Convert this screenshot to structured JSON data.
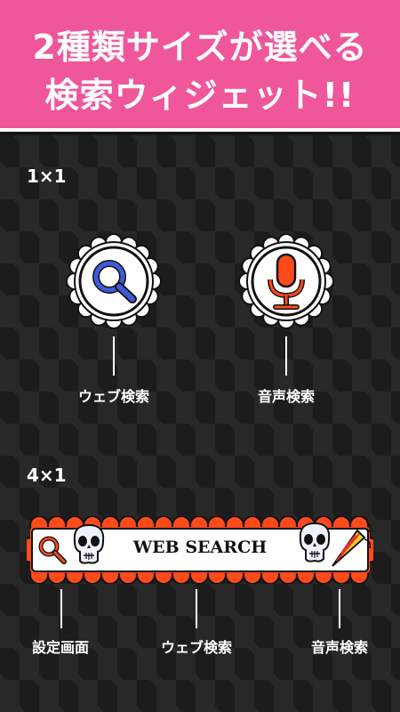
{
  "banner": {
    "line1": "2種類サイズが選べる",
    "line2": "検索ウィジェット!!",
    "background": "#f0579b"
  },
  "sections": {
    "small_label": "1×1",
    "wide_label": "4×1"
  },
  "small_widgets": [
    {
      "icon": "search-icon",
      "caption": "ウェブ検索"
    },
    {
      "icon": "microphone-icon",
      "caption": "音声検索"
    }
  ],
  "wide_widget": {
    "title": "WEB SEARCH",
    "icons": [
      "search-icon",
      "skull-icon",
      "skull-icon",
      "party-horn-icon"
    ],
    "captions": [
      "設定画面",
      "ウェブ検索",
      "音声検索"
    ],
    "accent": "#ff4a1c"
  }
}
